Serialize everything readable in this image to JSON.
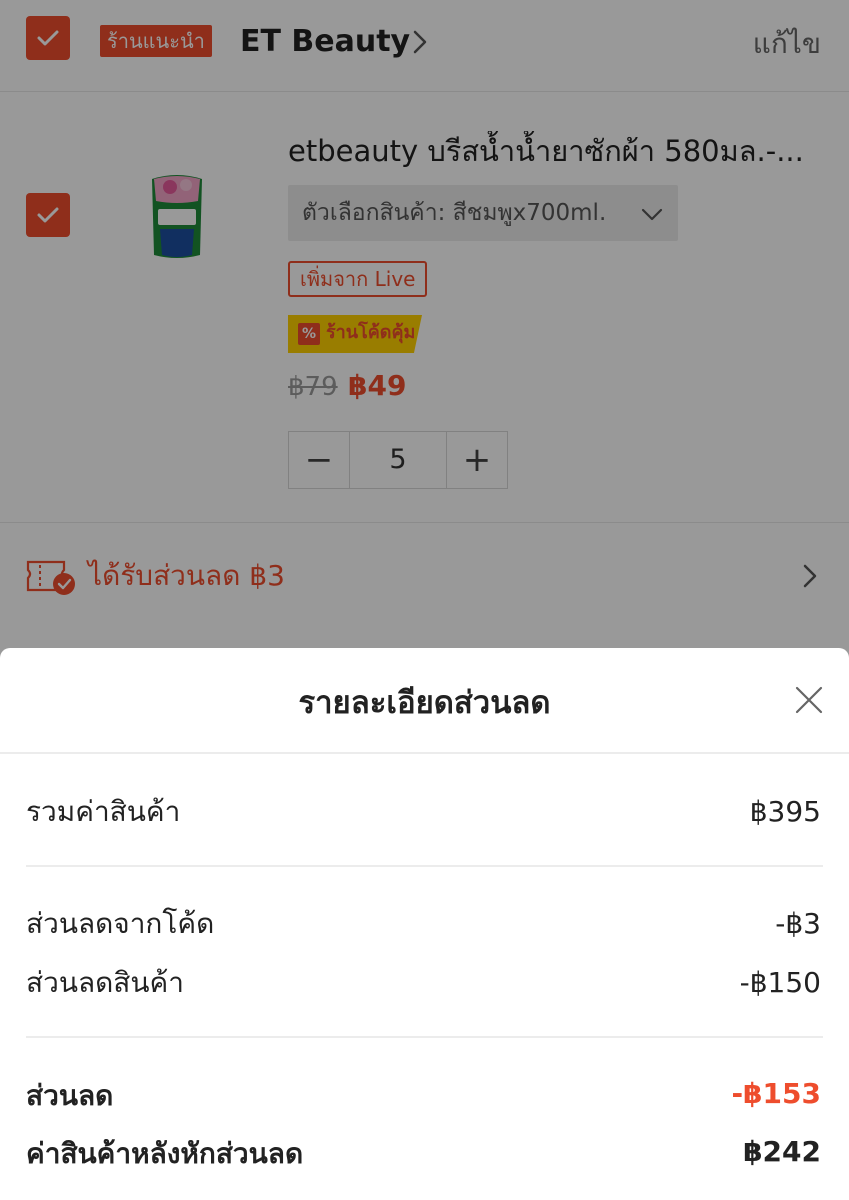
{
  "colors": {
    "accent": "#ee4d2d",
    "voucher_yellow": "#ffd100",
    "overlay": "rgba(0,0,0,0.4)"
  },
  "shop": {
    "badge": "ร้านแนะนำ",
    "name": "ET Beauty",
    "edit": "แก้ไข"
  },
  "item": {
    "title": "etbeauty บรีสน้ำน้ำยาซักผ้า 580มล.-...",
    "variant": "ตัวเลือกสินค้า: สีชมพูx700ml.",
    "live_tag": "เพิ่มจาก Live",
    "voucher_tag": "ร้านโค้ดคุ้ม",
    "voucher_icon": "%",
    "price_original": "฿79",
    "price_sale": "฿49",
    "quantity": "5",
    "decrement": "−",
    "increment": "+"
  },
  "discount_bar": {
    "text": "ได้รับส่วนลด ฿3"
  },
  "sheet": {
    "title": "รายละเอียดส่วนลด",
    "subtotal_label": "รวมค่าสินค้า",
    "subtotal_value": "฿395",
    "code_discount_label": "ส่วนลดจากโค้ด",
    "code_discount_value": "-฿3",
    "product_discount_label": "ส่วนลดสินค้า",
    "product_discount_value": "-฿150",
    "total_discount_label": "ส่วนลด",
    "total_discount_value": "-฿153",
    "final_label": "ค่าสินค้าหลังหักส่วนลด",
    "final_value": "฿242"
  }
}
